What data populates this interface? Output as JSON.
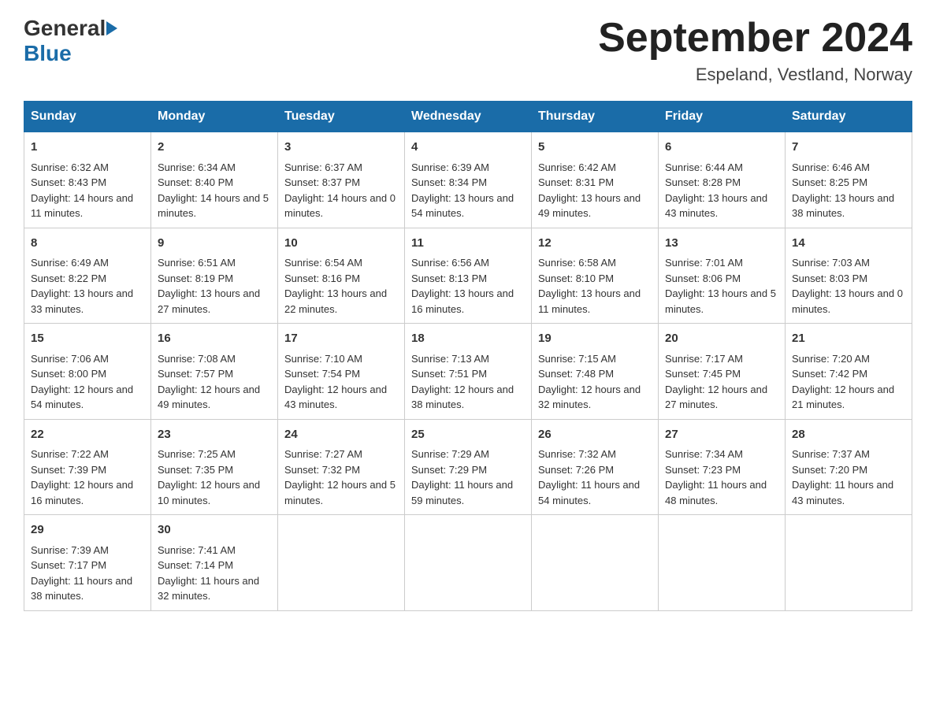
{
  "logo": {
    "general": "General",
    "blue": "Blue"
  },
  "title": "September 2024",
  "subtitle": "Espeland, Vestland, Norway",
  "weekdays": [
    "Sunday",
    "Monday",
    "Tuesday",
    "Wednesday",
    "Thursday",
    "Friday",
    "Saturday"
  ],
  "weeks": [
    [
      {
        "day": "1",
        "sunrise": "Sunrise: 6:32 AM",
        "sunset": "Sunset: 8:43 PM",
        "daylight": "Daylight: 14 hours and 11 minutes."
      },
      {
        "day": "2",
        "sunrise": "Sunrise: 6:34 AM",
        "sunset": "Sunset: 8:40 PM",
        "daylight": "Daylight: 14 hours and 5 minutes."
      },
      {
        "day": "3",
        "sunrise": "Sunrise: 6:37 AM",
        "sunset": "Sunset: 8:37 PM",
        "daylight": "Daylight: 14 hours and 0 minutes."
      },
      {
        "day": "4",
        "sunrise": "Sunrise: 6:39 AM",
        "sunset": "Sunset: 8:34 PM",
        "daylight": "Daylight: 13 hours and 54 minutes."
      },
      {
        "day": "5",
        "sunrise": "Sunrise: 6:42 AM",
        "sunset": "Sunset: 8:31 PM",
        "daylight": "Daylight: 13 hours and 49 minutes."
      },
      {
        "day": "6",
        "sunrise": "Sunrise: 6:44 AM",
        "sunset": "Sunset: 8:28 PM",
        "daylight": "Daylight: 13 hours and 43 minutes."
      },
      {
        "day": "7",
        "sunrise": "Sunrise: 6:46 AM",
        "sunset": "Sunset: 8:25 PM",
        "daylight": "Daylight: 13 hours and 38 minutes."
      }
    ],
    [
      {
        "day": "8",
        "sunrise": "Sunrise: 6:49 AM",
        "sunset": "Sunset: 8:22 PM",
        "daylight": "Daylight: 13 hours and 33 minutes."
      },
      {
        "day": "9",
        "sunrise": "Sunrise: 6:51 AM",
        "sunset": "Sunset: 8:19 PM",
        "daylight": "Daylight: 13 hours and 27 minutes."
      },
      {
        "day": "10",
        "sunrise": "Sunrise: 6:54 AM",
        "sunset": "Sunset: 8:16 PM",
        "daylight": "Daylight: 13 hours and 22 minutes."
      },
      {
        "day": "11",
        "sunrise": "Sunrise: 6:56 AM",
        "sunset": "Sunset: 8:13 PM",
        "daylight": "Daylight: 13 hours and 16 minutes."
      },
      {
        "day": "12",
        "sunrise": "Sunrise: 6:58 AM",
        "sunset": "Sunset: 8:10 PM",
        "daylight": "Daylight: 13 hours and 11 minutes."
      },
      {
        "day": "13",
        "sunrise": "Sunrise: 7:01 AM",
        "sunset": "Sunset: 8:06 PM",
        "daylight": "Daylight: 13 hours and 5 minutes."
      },
      {
        "day": "14",
        "sunrise": "Sunrise: 7:03 AM",
        "sunset": "Sunset: 8:03 PM",
        "daylight": "Daylight: 13 hours and 0 minutes."
      }
    ],
    [
      {
        "day": "15",
        "sunrise": "Sunrise: 7:06 AM",
        "sunset": "Sunset: 8:00 PM",
        "daylight": "Daylight: 12 hours and 54 minutes."
      },
      {
        "day": "16",
        "sunrise": "Sunrise: 7:08 AM",
        "sunset": "Sunset: 7:57 PM",
        "daylight": "Daylight: 12 hours and 49 minutes."
      },
      {
        "day": "17",
        "sunrise": "Sunrise: 7:10 AM",
        "sunset": "Sunset: 7:54 PM",
        "daylight": "Daylight: 12 hours and 43 minutes."
      },
      {
        "day": "18",
        "sunrise": "Sunrise: 7:13 AM",
        "sunset": "Sunset: 7:51 PM",
        "daylight": "Daylight: 12 hours and 38 minutes."
      },
      {
        "day": "19",
        "sunrise": "Sunrise: 7:15 AM",
        "sunset": "Sunset: 7:48 PM",
        "daylight": "Daylight: 12 hours and 32 minutes."
      },
      {
        "day": "20",
        "sunrise": "Sunrise: 7:17 AM",
        "sunset": "Sunset: 7:45 PM",
        "daylight": "Daylight: 12 hours and 27 minutes."
      },
      {
        "day": "21",
        "sunrise": "Sunrise: 7:20 AM",
        "sunset": "Sunset: 7:42 PM",
        "daylight": "Daylight: 12 hours and 21 minutes."
      }
    ],
    [
      {
        "day": "22",
        "sunrise": "Sunrise: 7:22 AM",
        "sunset": "Sunset: 7:39 PM",
        "daylight": "Daylight: 12 hours and 16 minutes."
      },
      {
        "day": "23",
        "sunrise": "Sunrise: 7:25 AM",
        "sunset": "Sunset: 7:35 PM",
        "daylight": "Daylight: 12 hours and 10 minutes."
      },
      {
        "day": "24",
        "sunrise": "Sunrise: 7:27 AM",
        "sunset": "Sunset: 7:32 PM",
        "daylight": "Daylight: 12 hours and 5 minutes."
      },
      {
        "day": "25",
        "sunrise": "Sunrise: 7:29 AM",
        "sunset": "Sunset: 7:29 PM",
        "daylight": "Daylight: 11 hours and 59 minutes."
      },
      {
        "day": "26",
        "sunrise": "Sunrise: 7:32 AM",
        "sunset": "Sunset: 7:26 PM",
        "daylight": "Daylight: 11 hours and 54 minutes."
      },
      {
        "day": "27",
        "sunrise": "Sunrise: 7:34 AM",
        "sunset": "Sunset: 7:23 PM",
        "daylight": "Daylight: 11 hours and 48 minutes."
      },
      {
        "day": "28",
        "sunrise": "Sunrise: 7:37 AM",
        "sunset": "Sunset: 7:20 PM",
        "daylight": "Daylight: 11 hours and 43 minutes."
      }
    ],
    [
      {
        "day": "29",
        "sunrise": "Sunrise: 7:39 AM",
        "sunset": "Sunset: 7:17 PM",
        "daylight": "Daylight: 11 hours and 38 minutes."
      },
      {
        "day": "30",
        "sunrise": "Sunrise: 7:41 AM",
        "sunset": "Sunset: 7:14 PM",
        "daylight": "Daylight: 11 hours and 32 minutes."
      },
      null,
      null,
      null,
      null,
      null
    ]
  ]
}
